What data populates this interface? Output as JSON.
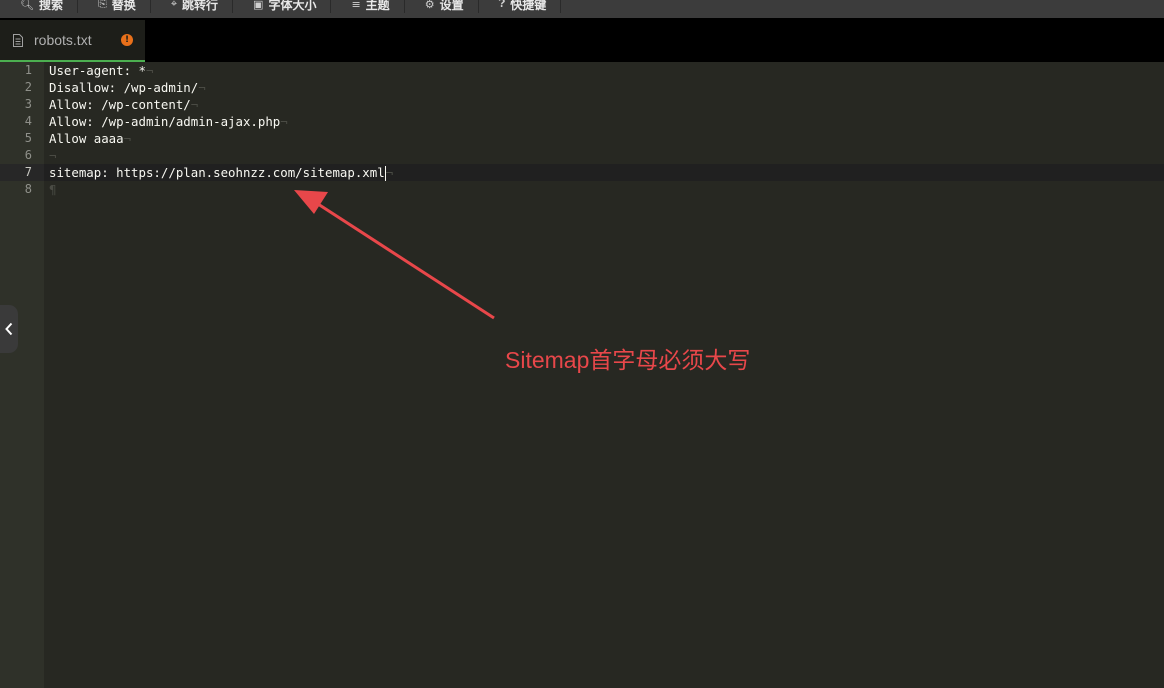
{
  "toolbar": {
    "items": [
      {
        "label": "搜索",
        "icon": "search-icon"
      },
      {
        "label": "替换",
        "icon": "replace-icon"
      },
      {
        "label": "跳转行",
        "icon": "goto-line-icon"
      },
      {
        "label": "字体大小",
        "icon": "font-size-icon"
      },
      {
        "label": "主题",
        "icon": "theme-icon"
      },
      {
        "label": "设置",
        "icon": "gear-icon"
      },
      {
        "label": "快捷键",
        "icon": "help-icon"
      }
    ]
  },
  "tab": {
    "filename": "robots.txt",
    "unsaved_marker": "!",
    "accent_color": "#4caf50",
    "unsaved_color": "#e8701a"
  },
  "editor": {
    "line_numbers": [
      "1",
      "2",
      "3",
      "4",
      "5",
      "6",
      "7",
      "8"
    ],
    "lines": [
      {
        "text": "User-agent: *",
        "eol": "¬"
      },
      {
        "text": "Disallow: /wp-admin/",
        "eol": "¬"
      },
      {
        "text": "Allow: /wp-content/",
        "eol": "¬"
      },
      {
        "text": "Allow: /wp-admin/admin-ajax.php",
        "eol": "¬"
      },
      {
        "text": "Allow aaaa",
        "eol": "¬"
      },
      {
        "text": "",
        "eol": "¬"
      },
      {
        "text": "sitemap: https://plan.seohnzz.com/sitemap.xml",
        "eol": "¬"
      },
      {
        "text": "",
        "eol": "¶"
      }
    ],
    "active_line": 7,
    "theme_background": "#272822"
  },
  "annotation": {
    "text": "Sitemap首字母必须大写",
    "color": "#e8474a"
  }
}
